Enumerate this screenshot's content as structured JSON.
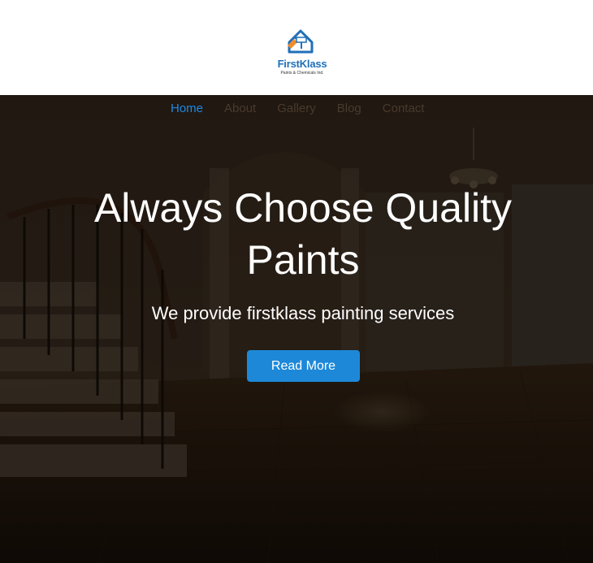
{
  "brand": {
    "name": "FirstKlass",
    "tagline": "Paints & Chemicals Ind."
  },
  "nav": {
    "items": [
      {
        "label": "Home",
        "active": true
      },
      {
        "label": "About",
        "active": false
      },
      {
        "label": "Gallery",
        "active": false
      },
      {
        "label": "Blog",
        "active": false
      },
      {
        "label": "Contact",
        "active": false
      }
    ]
  },
  "hero": {
    "headline_line1": "Always Choose Quality",
    "headline_line2": "Paints",
    "subheadline": "We provide firstklass painting services",
    "cta_label": "Read More"
  },
  "colors": {
    "accent": "#1e88d8",
    "nav_active": "#1e88e5",
    "brand_blue": "#1f6fb8",
    "brand_orange": "#f28c28"
  },
  "icons": {
    "logo": "paint-roller-house-icon"
  }
}
